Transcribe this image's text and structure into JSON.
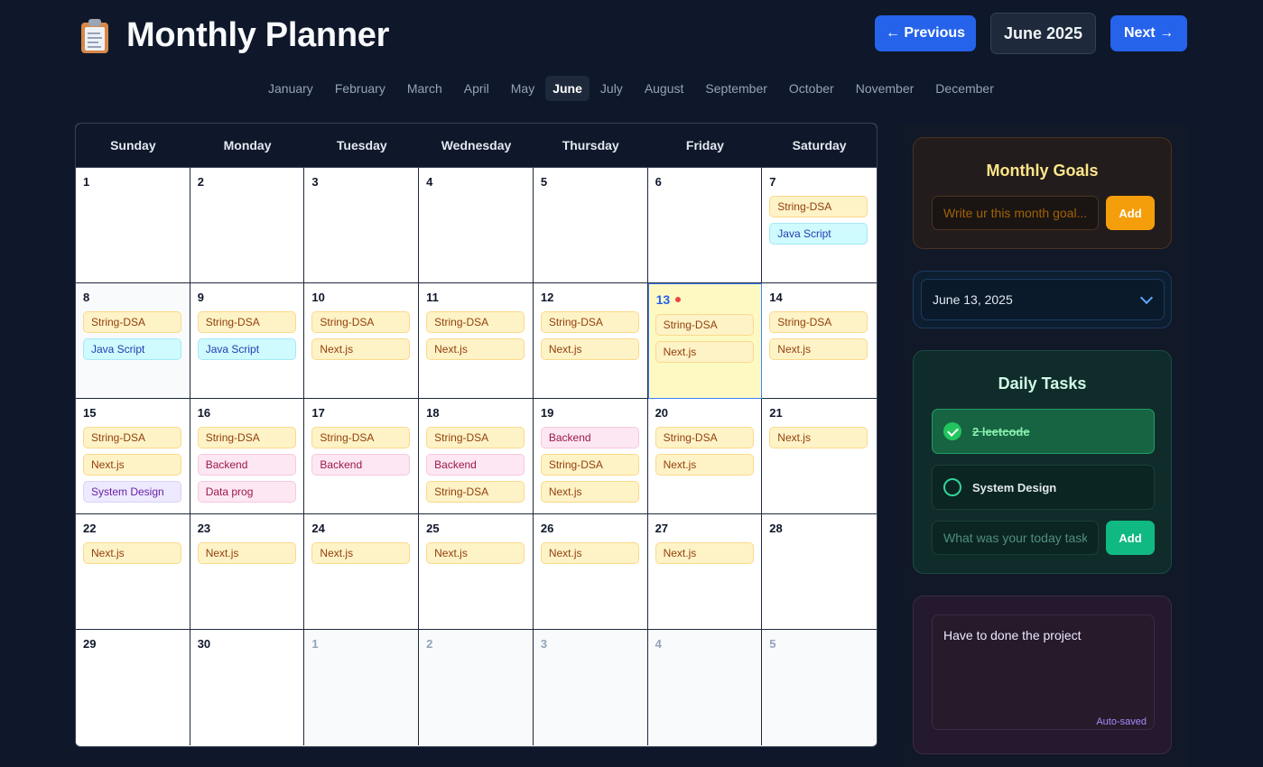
{
  "header": {
    "title": "Monthly Planner",
    "prev_label": "← Previous",
    "next_label": "Next →",
    "current_month": "June 2025"
  },
  "months": [
    "January",
    "February",
    "March",
    "April",
    "May",
    "June",
    "July",
    "August",
    "September",
    "October",
    "November",
    "December"
  ],
  "active_month_index": 5,
  "weekdays": [
    "Sunday",
    "Monday",
    "Tuesday",
    "Wednesday",
    "Thursday",
    "Friday",
    "Saturday"
  ],
  "today": "13",
  "days": [
    {
      "n": "1",
      "events": []
    },
    {
      "n": "2",
      "events": []
    },
    {
      "n": "3",
      "events": []
    },
    {
      "n": "4",
      "events": []
    },
    {
      "n": "5",
      "events": []
    },
    {
      "n": "6",
      "events": []
    },
    {
      "n": "7",
      "events": [
        {
          "label": "String-DSA",
          "color": "orange"
        },
        {
          "label": "Java Script",
          "color": "blue"
        }
      ]
    },
    {
      "n": "8",
      "muted": true,
      "events": [
        {
          "label": "String-DSA",
          "color": "orange"
        },
        {
          "label": "Java Script",
          "color": "blue"
        }
      ]
    },
    {
      "n": "9",
      "events": [
        {
          "label": "String-DSA",
          "color": "orange"
        },
        {
          "label": "Java Script",
          "color": "blue"
        }
      ]
    },
    {
      "n": "10",
      "events": [
        {
          "label": "String-DSA",
          "color": "orange"
        },
        {
          "label": "Next.js",
          "color": "orange"
        }
      ]
    },
    {
      "n": "11",
      "events": [
        {
          "label": "String-DSA",
          "color": "orange"
        },
        {
          "label": "Next.js",
          "color": "orange"
        }
      ]
    },
    {
      "n": "12",
      "events": [
        {
          "label": "String-DSA",
          "color": "orange"
        },
        {
          "label": "Next.js",
          "color": "orange"
        }
      ]
    },
    {
      "n": "13",
      "today": true,
      "events": [
        {
          "label": "String-DSA",
          "color": "orange"
        },
        {
          "label": "Next.js",
          "color": "orange"
        }
      ]
    },
    {
      "n": "14",
      "events": [
        {
          "label": "String-DSA",
          "color": "orange"
        },
        {
          "label": "Next.js",
          "color": "orange"
        }
      ]
    },
    {
      "n": "15",
      "events": [
        {
          "label": "String-DSA",
          "color": "orange"
        },
        {
          "label": "Next.js",
          "color": "orange"
        },
        {
          "label": "System Design",
          "color": "purple"
        }
      ]
    },
    {
      "n": "16",
      "events": [
        {
          "label": "String-DSA",
          "color": "orange"
        },
        {
          "label": "Backend",
          "color": "pink"
        },
        {
          "label": "Data prog",
          "color": "pink"
        }
      ]
    },
    {
      "n": "17",
      "events": [
        {
          "label": "String-DSA",
          "color": "orange"
        },
        {
          "label": "Backend",
          "color": "pink"
        }
      ]
    },
    {
      "n": "18",
      "events": [
        {
          "label": "String-DSA",
          "color": "orange"
        },
        {
          "label": "Backend",
          "color": "pink"
        },
        {
          "label": "String-DSA",
          "color": "orange"
        }
      ]
    },
    {
      "n": "19",
      "events": [
        {
          "label": "Backend",
          "color": "pink"
        },
        {
          "label": "String-DSA",
          "color": "orange"
        },
        {
          "label": "Next.js",
          "color": "orange"
        }
      ]
    },
    {
      "n": "20",
      "events": [
        {
          "label": "String-DSA",
          "color": "orange"
        },
        {
          "label": "Next.js",
          "color": "orange"
        }
      ]
    },
    {
      "n": "21",
      "events": [
        {
          "label": "Next.js",
          "color": "orange"
        }
      ]
    },
    {
      "n": "22",
      "events": [
        {
          "label": "Next.js",
          "color": "orange"
        }
      ]
    },
    {
      "n": "23",
      "events": [
        {
          "label": "Next.js",
          "color": "orange"
        }
      ]
    },
    {
      "n": "24",
      "events": [
        {
          "label": "Next.js",
          "color": "orange"
        }
      ]
    },
    {
      "n": "25",
      "events": [
        {
          "label": "Next.js",
          "color": "orange"
        }
      ]
    },
    {
      "n": "26",
      "events": [
        {
          "label": "Next.js",
          "color": "orange"
        }
      ]
    },
    {
      "n": "27",
      "events": [
        {
          "label": "Next.js",
          "color": "orange"
        }
      ]
    },
    {
      "n": "28",
      "events": []
    },
    {
      "n": "29",
      "events": []
    },
    {
      "n": "30",
      "events": []
    },
    {
      "n": "1",
      "other": true,
      "events": []
    },
    {
      "n": "2",
      "other": true,
      "events": []
    },
    {
      "n": "3",
      "other": true,
      "events": []
    },
    {
      "n": "4",
      "other": true,
      "events": []
    },
    {
      "n": "5",
      "other": true,
      "events": []
    }
  ],
  "goals": {
    "title": "Monthly Goals",
    "placeholder": "Write ur this month goal...",
    "add_label": "Add"
  },
  "date_picker": {
    "value": "June 13, 2025"
  },
  "tasks": {
    "title": "Daily Tasks",
    "items": [
      {
        "label": "2 leetcode",
        "done": true
      },
      {
        "label": "System Design",
        "done": false
      }
    ],
    "placeholder": "What was your today task",
    "add_label": "Add"
  },
  "notes": {
    "text": "Have to done the project",
    "autosave_label": "Auto-saved"
  },
  "colors": {
    "background": "#0f172a",
    "accent_blue": "#2563eb",
    "goals_button": "#f59e0b",
    "tasks_button": "#10b981",
    "today_highlight": "#fef9c3"
  }
}
